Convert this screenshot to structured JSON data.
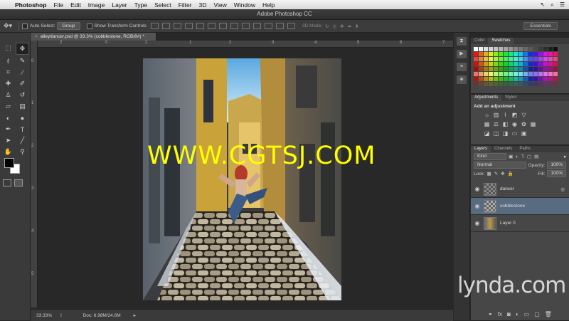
{
  "menubar": {
    "items": [
      "Photoshop",
      "File",
      "Edit",
      "Image",
      "Layer",
      "Type",
      "Select",
      "Filter",
      "3D",
      "View",
      "Window",
      "Help"
    ]
  },
  "window": {
    "title": "Adobe Photoshop CC"
  },
  "options": {
    "auto_select_label": "Auto-Select:",
    "auto_select_value": "Group",
    "transform_label": "Show Transform Controls",
    "mode_3d": "3D Mode:",
    "workspace": "Essentials"
  },
  "document": {
    "tab_title": "alleydancer.psd @ 33.3% (cobblestone, RGB/8#) *",
    "ruler_top": [
      "2",
      "0",
      "2",
      "1",
      "2",
      "3",
      "4",
      "5",
      "6",
      "7"
    ],
    "ruler_left": [
      "0",
      "1",
      "2",
      "3",
      "4",
      "5"
    ],
    "zoom": "33.33%",
    "doc_size": "Doc: 6.98M/24.6M"
  },
  "panels": {
    "color_tabs": [
      "Color",
      "Swatches"
    ],
    "adjust_tabs": [
      "Adjustments",
      "Styles"
    ],
    "add_adjustment": "Add an adjustment",
    "layers_tabs": [
      "Layers",
      "Channels",
      "Paths"
    ],
    "kind_filter": "Kind",
    "blend_mode": "Normal",
    "opacity_label": "Opacity:",
    "opacity_value": "100%",
    "lock_label": "Lock:",
    "fill_label": "Fill:",
    "fill_value": "100%",
    "layers": [
      {
        "name": "dancer",
        "selected": false
      },
      {
        "name": "cobblestone",
        "selected": true
      },
      {
        "name": "Layer 0",
        "selected": false
      }
    ]
  },
  "watermark": "WWW.CGTSJ.COM",
  "brand": "lynda.com",
  "colors": {
    "accent_selected_layer": "#586b81",
    "watermark": "#ffff00"
  }
}
